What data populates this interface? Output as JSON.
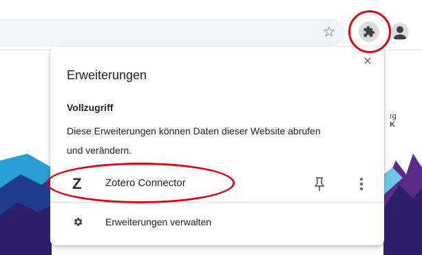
{
  "toolbar": {
    "star_glyph": "☆",
    "icons": [
      "bookmark-star-icon",
      "extensions-puzzle-icon",
      "profile-avatar-icon"
    ]
  },
  "webpage": {
    "side_text_1": "rg",
    "side_text_2": "K"
  },
  "extensions_popup": {
    "title": "Erweiterungen",
    "close_glyph": "×",
    "section_heading": "Vollzugriff",
    "section_description": "Diese Erweiterungen können Daten dieser Website abrufen und verändern.",
    "extensions": [
      {
        "icon_letter": "Z",
        "name": "Zotero Connector"
      }
    ],
    "manage_label": "Erweiterungen verwalten"
  },
  "annotations": {
    "highlight_color": "#e60012"
  }
}
